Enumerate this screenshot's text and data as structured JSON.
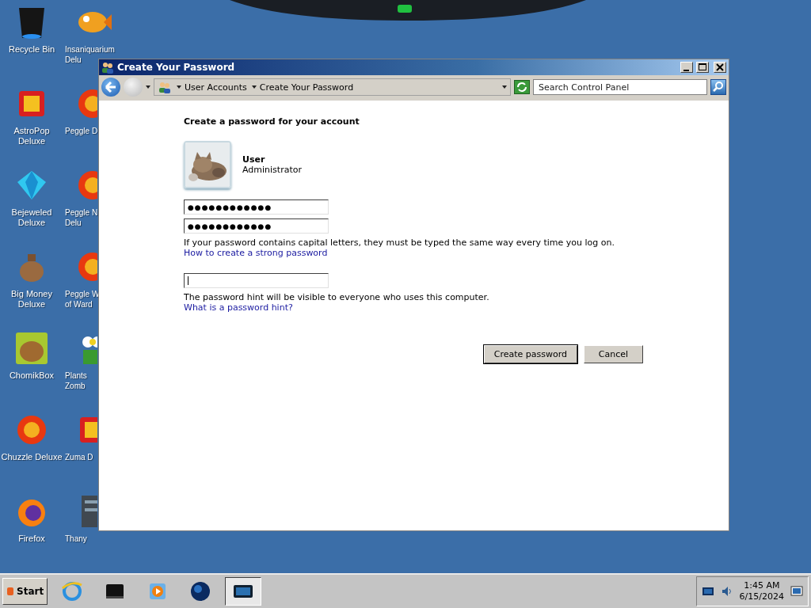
{
  "desktop_icons": [
    {
      "kind": "bin",
      "lines": [
        "Recycle Bin"
      ]
    },
    {
      "kind": "fish",
      "lines": [
        "Insaniquarium",
        "Delu"
      ]
    },
    {
      "kind": "game",
      "lines": [
        "AstroPop",
        "Deluxe"
      ]
    },
    {
      "kind": "ball",
      "lines": [
        "Peggle D"
      ]
    },
    {
      "kind": "gem",
      "lines": [
        "Bejeweled",
        "Deluxe"
      ]
    },
    {
      "kind": "ball",
      "lines": [
        "Peggle N",
        "Delu"
      ]
    },
    {
      "kind": "bag",
      "lines": [
        "Big Money",
        "Deluxe"
      ]
    },
    {
      "kind": "ball",
      "lines": [
        "Peggle W",
        "of Ward"
      ]
    },
    {
      "kind": "hamster",
      "lines": [
        "ChomikBox"
      ]
    },
    {
      "kind": "flower",
      "lines": [
        "Plants",
        "Zomb"
      ]
    },
    {
      "kind": "ball",
      "lines": [
        "Chuzzle Deluxe"
      ]
    },
    {
      "kind": "game",
      "lines": [
        "Zuma D"
      ]
    },
    {
      "kind": "fox",
      "lines": [
        "Firefox"
      ]
    },
    {
      "kind": "server",
      "lines": [
        "Thany"
      ]
    }
  ],
  "window": {
    "title": "Create Your Password",
    "breadcrumb": [
      "User Accounts",
      "Create Your Password"
    ],
    "search": {
      "placeholder": "Search Control Panel"
    },
    "heading": "Create a password for your account",
    "account": {
      "name": "User",
      "role": "Administrator"
    },
    "password_fields": [
      {
        "value": "●●●●●●●●●●●●"
      },
      {
        "value": "●●●●●●●●●●●●"
      }
    ],
    "case_note": "If your password contains capital letters, they must be typed the same way every time you log on.",
    "strong_link": "How to create a strong password",
    "hint_field": {
      "focused": true
    },
    "hint_note": "The password hint will be visible to everyone who uses this computer.",
    "hint_link": "What is a password hint?",
    "buttons": [
      {
        "label": "Create password",
        "default": true
      },
      {
        "label": "Cancel",
        "default": false
      }
    ]
  },
  "taskbar": {
    "start": "Start",
    "quick_launch": [
      {
        "kind": "ie",
        "selected": false
      },
      {
        "kind": "box",
        "selected": false
      },
      {
        "kind": "player",
        "selected": false
      },
      {
        "kind": "globe",
        "selected": false
      },
      {
        "kind": "screen",
        "selected": true
      }
    ],
    "time": "1:45 AM",
    "date": "6/15/2024"
  }
}
